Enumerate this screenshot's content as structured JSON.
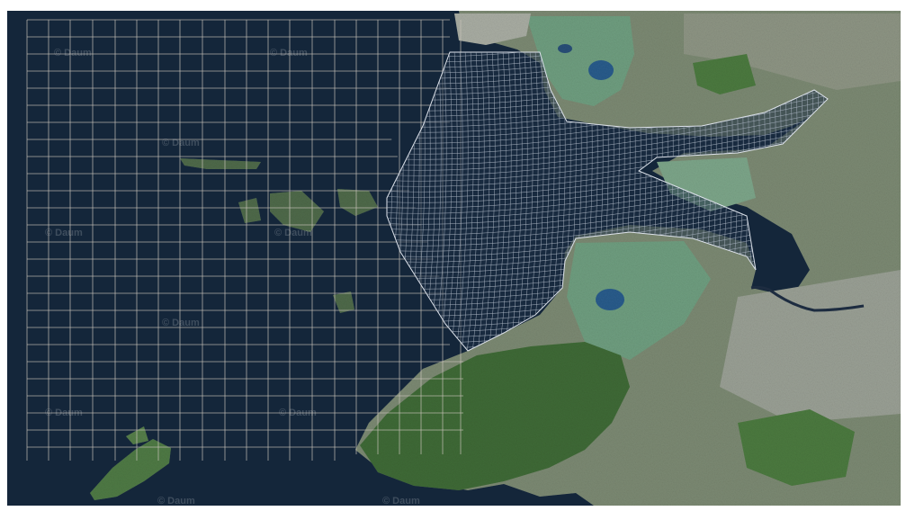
{
  "map": {
    "watermark": "© Daum",
    "colors": {
      "sea": "#14263a",
      "land": "#7c8a73",
      "forest": "#3f6a36",
      "farm": "#6f9e80",
      "urban": "#a9ada3",
      "grid": "#c9c3ba",
      "mesh": "#aab4c2",
      "river": "#1d2c40"
    }
  }
}
